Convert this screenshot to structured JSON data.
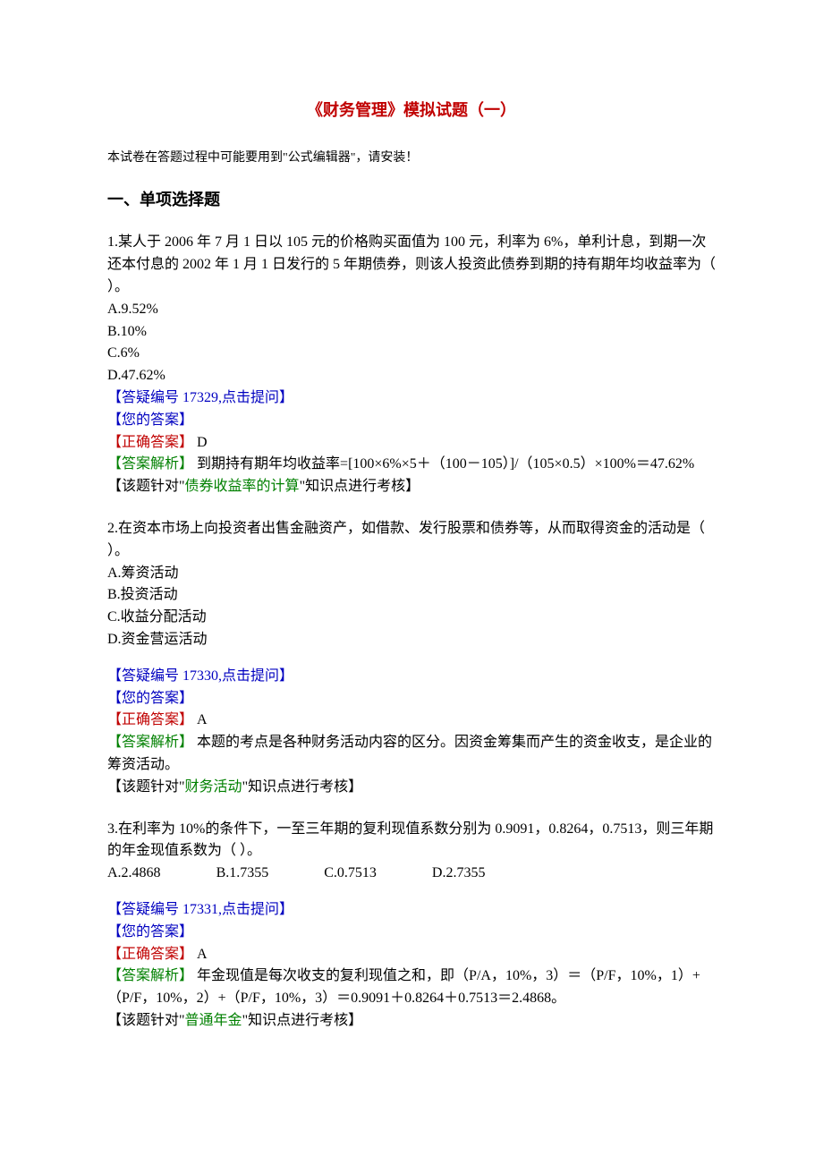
{
  "title": "《财务管理》模拟试题（一）",
  "note": "本试卷在答题过程中可能要用到\"公式编辑器\"，请安装！",
  "sectionHeading": "一、单项选择题",
  "labels": {
    "yourAnswer": "您的答案",
    "correctAnswer": "正确答案",
    "analysis": "答案解析",
    "knowledgePrefix": "【该题针对\"",
    "knowledgeSuffix": "\"知识点进行考核】"
  },
  "q1": {
    "stem": "1.某人于 2006 年 7 月 1 日以 105 元的价格购买面值为 100 元，利率为 6%，单利计息，到期一次还本付息的 2002 年 1 月 1 日发行的 5 年期债券，则该人投资此债券到期的持有期年均收益率为（ ）。",
    "optA": "A.9.52%",
    "optB": "B.10%",
    "optC": "C.6%",
    "optD": "D.47.62%",
    "qaLink": "答疑编号 17329,点击提问",
    "correct": " D",
    "analysisText": " 到期持有期年均收益率=[100×6%×5＋（100－105）]/（105×0.5）×100%＝47.62%",
    "knowledgePoint": "债券收益率的计算"
  },
  "q2": {
    "stem": "2.在资本市场上向投资者出售金融资产，如借款、发行股票和债券等，从而取得资金的活动是（ ）。",
    "optA": "A.筹资活动",
    "optB": "B.投资活动",
    "optC": "C.收益分配活动",
    "optD": "D.资金营运活动",
    "qaLink": "答疑编号 17330,点击提问",
    "correct": " A",
    "analysisText": " 本题的考点是各种财务活动内容的区分。因资金筹集而产生的资金收支，是企业的筹资活动。",
    "knowledgePoint": "财务活动"
  },
  "q3": {
    "stem": "3.在利率为 10%的条件下，一至三年期的复利现值系数分别为 0.9091，0.8264，0.7513，则三年期的年金现值系数为（ ）。",
    "optA": "A.2.4868",
    "optB": "B.1.7355",
    "optC": "C.0.7513",
    "optD": "D.2.7355",
    "qaLink": "答疑编号 17331,点击提问",
    "correct": " A",
    "analysisText": " 年金现值是每次收支的复利现值之和，即（P/A，10%，3）＝（P/F，10%，1）+（P/F，10%，2）+（P/F，10%，3）＝0.9091＋0.8264＋0.7513＝2.4868。",
    "knowledgePoint": "普通年金"
  }
}
